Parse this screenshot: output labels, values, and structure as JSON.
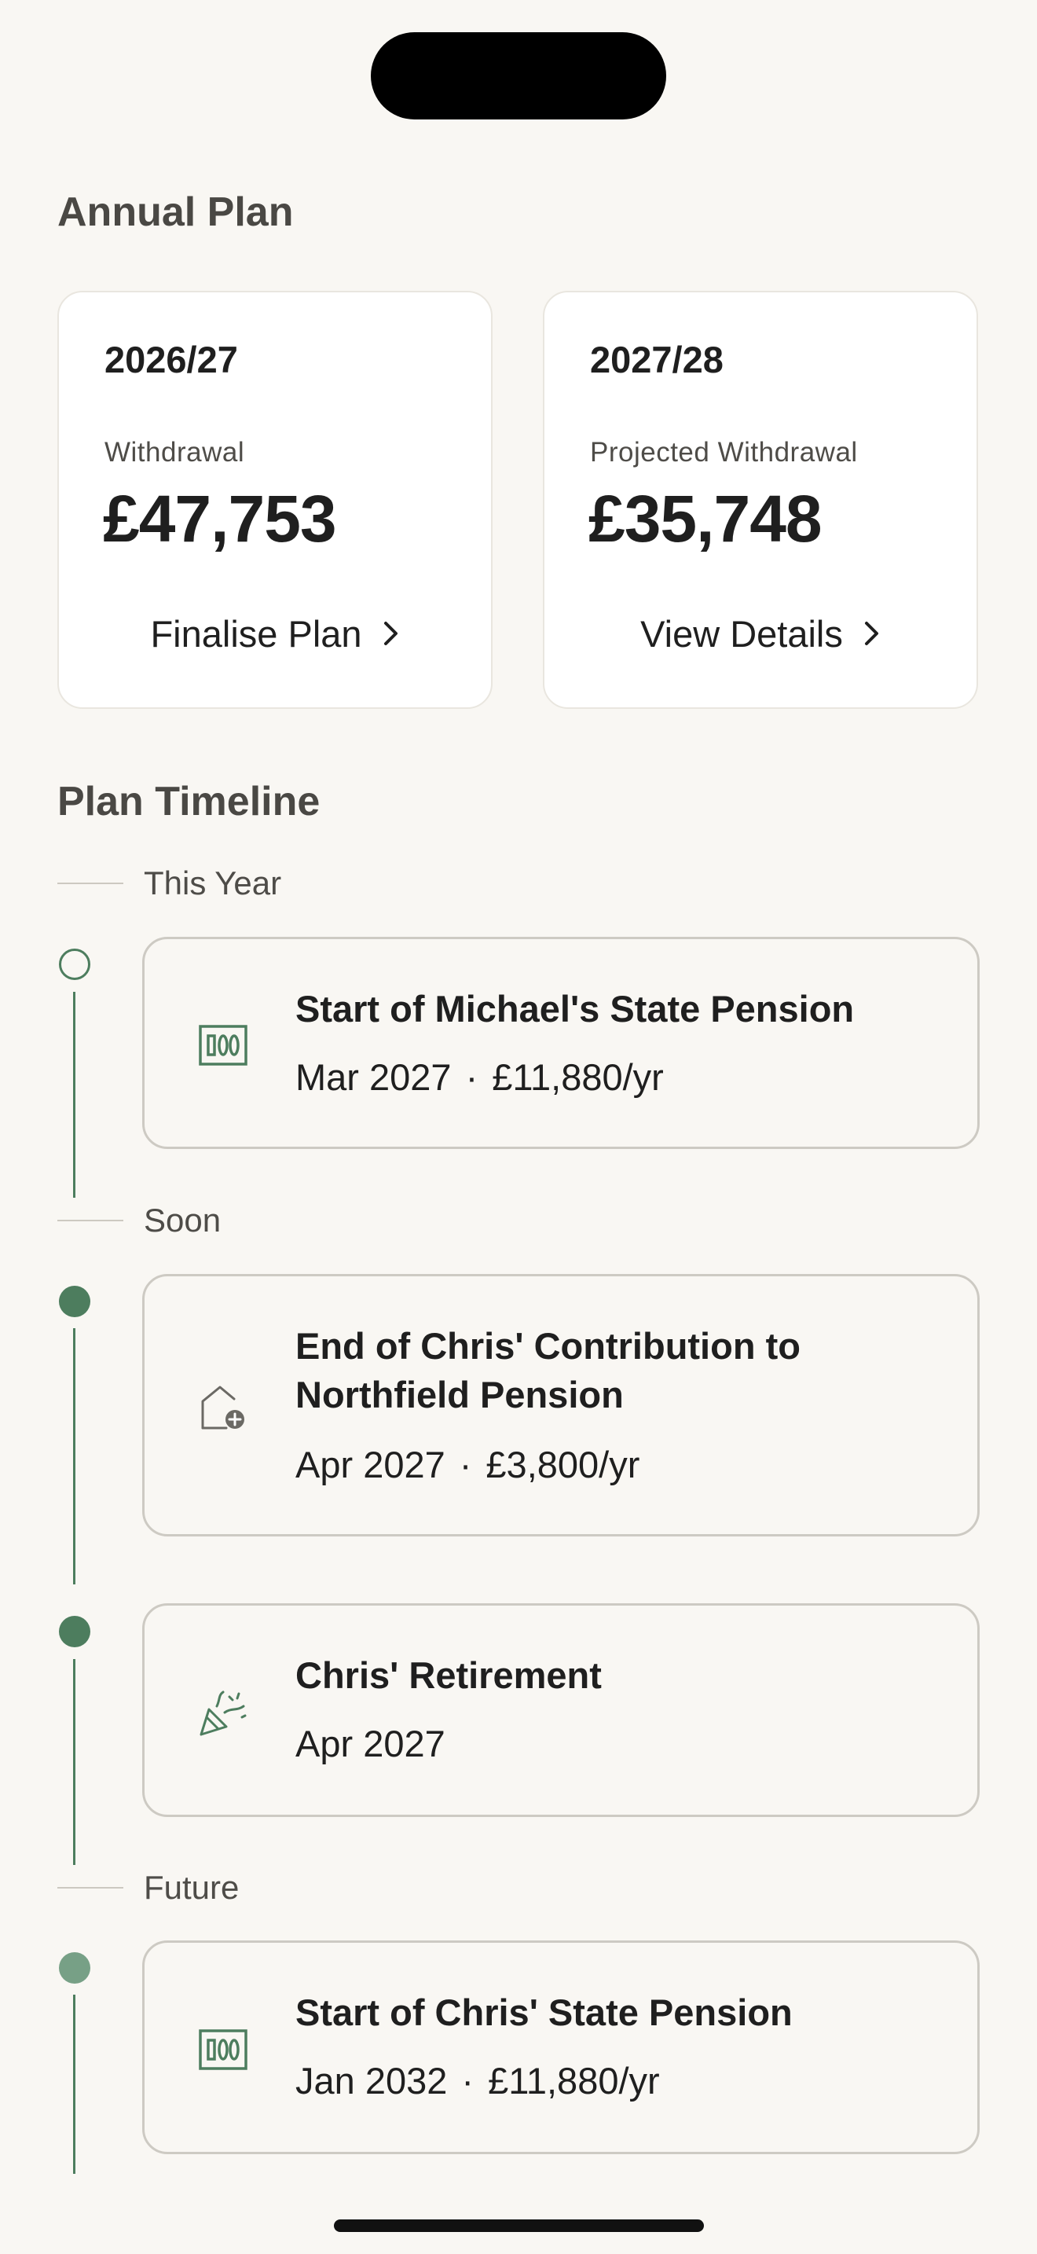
{
  "annual_plan": {
    "title": "Annual Plan",
    "cards": [
      {
        "year": "2026/27",
        "label": "Withdrawal",
        "amount": "£47,753",
        "action": "Finalise Plan"
      },
      {
        "year": "2027/28",
        "label": "Projected Withdrawal",
        "amount": "£35,748",
        "action": "View Details"
      }
    ]
  },
  "timeline": {
    "title": "Plan Timeline",
    "groups": {
      "this_year": "This Year",
      "soon": "Soon",
      "future": "Future"
    },
    "events": [
      {
        "title": "Start of Michael's State Pension",
        "date": "Mar 2027",
        "amount": "£11,880/yr",
        "icon": "banknote-icon"
      },
      {
        "title": "End of Chris' Contribution to Northfield Pension",
        "date": "Apr 2027",
        "amount": "£3,800/yr",
        "icon": "house-plus-icon"
      },
      {
        "title": "Chris' Retirement",
        "date": "Apr 2027",
        "icon": "party-popper-icon"
      },
      {
        "title": "Start of Chris' State Pension",
        "date": "Jan 2032",
        "amount": "£11,880/yr",
        "icon": "banknote-icon"
      }
    ],
    "separator": "·"
  },
  "colors": {
    "background": "#f9f7f3",
    "accent_green": "#4d7d5e",
    "faded_green": "#77a086",
    "card_border": "#cdcac3",
    "text_primary": "#1f1f1f",
    "text_secondary": "#4a4844"
  }
}
